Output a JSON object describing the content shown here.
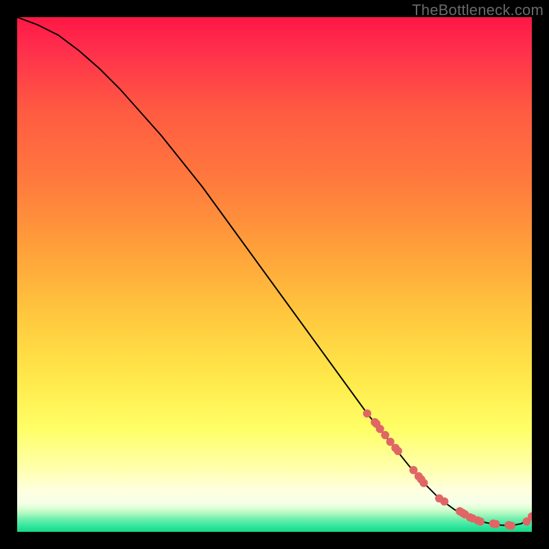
{
  "watermark": "TheBottleneck.com",
  "chart_data": {
    "type": "line",
    "title": "",
    "xlabel": "",
    "ylabel": "",
    "xlim": [
      0,
      100
    ],
    "ylim": [
      0,
      100
    ],
    "grid": false,
    "legend": false,
    "colors": {
      "gradient_top": "#ff1744",
      "gradient_mid_high": "#ff8a3d",
      "gradient_mid": "#ffd740",
      "gradient_mid_low": "#ffff66",
      "gradient_low_band": "#ffffcc",
      "gradient_bottom": "#2ee59d",
      "line": "#000000",
      "marker": "#e06666"
    },
    "series": [
      {
        "name": "curve",
        "type": "line",
        "x": [
          0,
          4,
          8,
          12,
          16,
          20,
          24,
          28,
          32,
          36,
          40,
          44,
          48,
          52,
          56,
          60,
          64,
          68,
          72,
          76,
          79,
          82,
          85,
          88,
          91,
          94,
          96,
          98,
          100
        ],
        "y": [
          100,
          98.5,
          96.5,
          93.5,
          90,
          86,
          81.5,
          77,
          72,
          67,
          61.5,
          56,
          50.5,
          45,
          39.5,
          34,
          28.5,
          23,
          18,
          13,
          9.5,
          6.5,
          4.3,
          2.8,
          1.8,
          1.3,
          1.2,
          1.6,
          3.0
        ]
      },
      {
        "name": "markers-upper",
        "type": "scatter",
        "x": [
          68.0,
          69.5,
          69.8,
          70.5,
          71.5,
          72.5,
          73.5,
          74.0,
          77.0,
          78.0,
          78.5,
          79.0
        ],
        "y": [
          23.0,
          21.3,
          21.0,
          20.0,
          18.8,
          17.5,
          16.3,
          15.7,
          12.0,
          10.8,
          10.2,
          9.5
        ]
      },
      {
        "name": "markers-lower",
        "type": "scatter",
        "x": [
          82.0,
          83.0,
          86.0,
          86.5,
          87.0,
          88.0,
          88.5,
          89.5,
          90.0,
          92.5,
          93.0,
          95.5,
          96.0,
          99.0,
          100.0
        ],
        "y": [
          6.5,
          5.9,
          4.0,
          3.7,
          3.4,
          2.8,
          2.6,
          2.2,
          2.0,
          1.6,
          1.5,
          1.3,
          1.2,
          2.0,
          3.0
        ]
      }
    ]
  }
}
